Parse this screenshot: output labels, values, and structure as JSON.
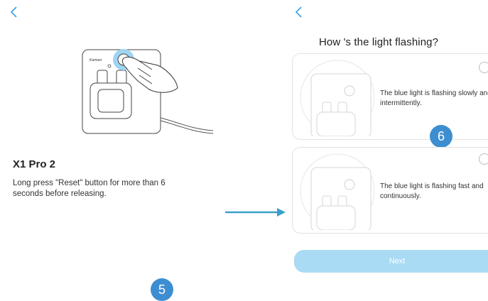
{
  "left_screen": {
    "back_icon": "chevron-left-icon",
    "brand": "Kamoer",
    "device_title": "X1 Pro 2",
    "instruction": "Long press \"Reset\" button for more than 6 seconds before releasing.",
    "step_badge": "5"
  },
  "right_screen": {
    "back_icon": "chevron-left-icon",
    "question": "How 's the light flashing?",
    "options": [
      {
        "label": "The blue light is flashing slowly and intermittently.",
        "selected": false
      },
      {
        "label": "The blue light is flashing fast and continuously.",
        "selected": false
      }
    ],
    "step_badge": "6",
    "next_label": "Next"
  },
  "colors": {
    "accent": "#3aa3e0",
    "badge": "#3d8ed0",
    "arrow": "#3aa0c8",
    "next_button": "#a9dbf5"
  }
}
